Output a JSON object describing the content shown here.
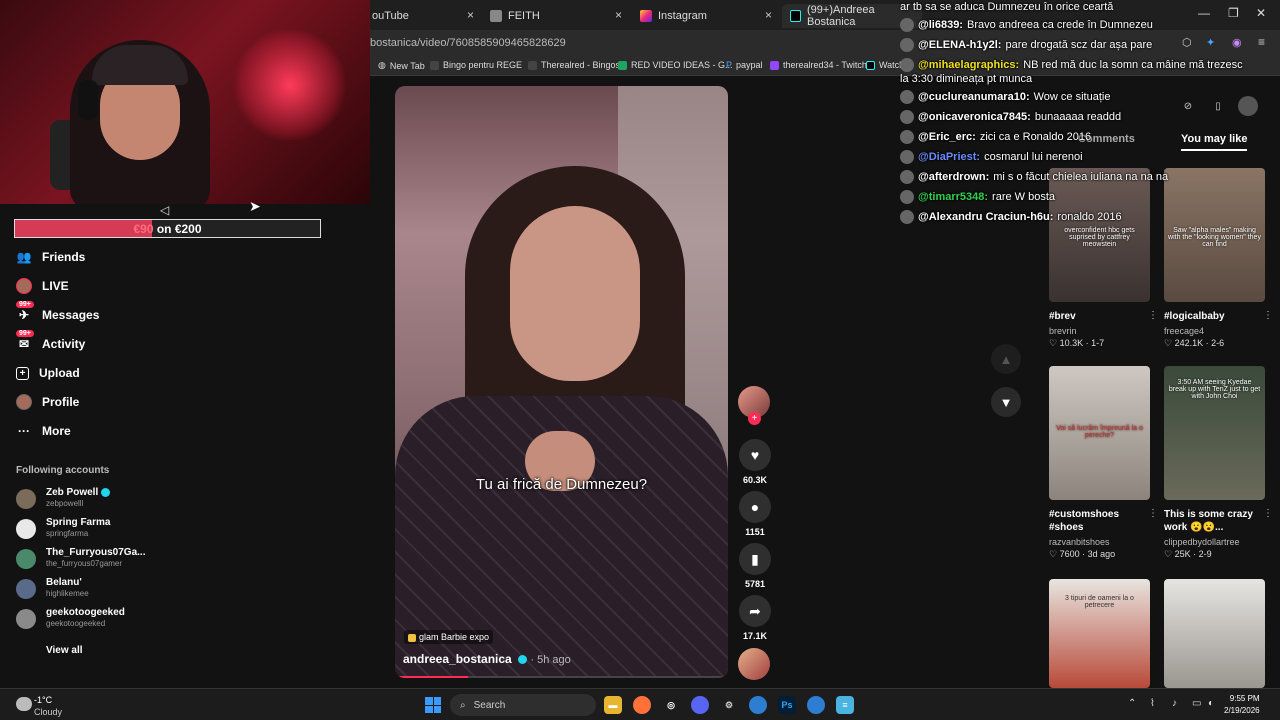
{
  "browser": {
    "tabs": [
      {
        "label": "ouTube",
        "close": "×"
      },
      {
        "label": "FEITH",
        "close": "×"
      },
      {
        "label": "Instagram",
        "close": "×"
      },
      {
        "label": "(99+)Andreea Bostanica",
        "close": "×"
      }
    ],
    "url": "bostanica/video/7608585909465828629",
    "bookmarks": [
      "New Tab",
      "Bingo pentru REGE",
      "Therealred - Bingos",
      "RED VIDEO IDEAS - G...",
      "paypal",
      "therealred34 - Twitch",
      "Watch"
    ],
    "window_controls": [
      "—",
      "❐",
      "✕"
    ]
  },
  "stream": {
    "donation_text_amount": "€90",
    "donation_text_rest": " on €200",
    "donation_progress": 0.45
  },
  "sidebar": {
    "items": [
      {
        "label": "Friends",
        "icon": "friends-icon"
      },
      {
        "label": "LIVE",
        "icon": "live-icon"
      },
      {
        "label": "Messages",
        "icon": "messages-icon",
        "badge": "99+"
      },
      {
        "label": "Activity",
        "icon": "activity-icon",
        "badge": "99+"
      },
      {
        "label": "Upload",
        "icon": "upload-icon"
      },
      {
        "label": "Profile",
        "icon": "profile-icon"
      },
      {
        "label": "More",
        "icon": "more-icon"
      }
    ],
    "following_header": "Following accounts",
    "accounts": [
      {
        "name": "Zeb Powell",
        "handle": "zebpowelll",
        "verified": true,
        "color": "#7a6b5a"
      },
      {
        "name": "Spring Farma",
        "handle": "springfarma",
        "verified": false,
        "color": "#e8e8e8"
      },
      {
        "name": "The_Furryous07Ga...",
        "handle": "the_furryous07gamer",
        "verified": false,
        "color": "#4a8a6a"
      },
      {
        "name": "Belanu'",
        "handle": "highlikemee",
        "verified": false,
        "color": "#5a6b8a"
      },
      {
        "name": "geekotoogeeked",
        "handle": "geekotoogeeked",
        "verified": false,
        "color": "#8a8a8a"
      }
    ],
    "view_all": "View all"
  },
  "video": {
    "caption": "Tu ai frică de Dumnezeu?",
    "tag": "glam Barbie expo",
    "author": "andreea_bostanica",
    "ago": "· 5h ago",
    "progress": 0.22
  },
  "actions": {
    "likes": "60.3K",
    "comments": "1151",
    "saves": "5781",
    "shares": "17.1K"
  },
  "chat": [
    {
      "user": "",
      "msg": "ar tb sa se aduca Dumnezeu în orice ceartă",
      "color": "#ffffff"
    },
    {
      "user": "@li6839:",
      "msg": "Bravo andreea ca crede în Dumnezeu",
      "color": "#ffffff"
    },
    {
      "user": "@ELENA-h1y2l:",
      "msg": "pare drogată scz dar așa pare",
      "color": "#ffffff"
    },
    {
      "user": "@mihaelagraphics:",
      "msg": "NB red mă duc la somn ca mâine mă trezesc",
      "color": "#f0e020"
    },
    {
      "user": "",
      "msg": "la 3:30 dimineața pt munca",
      "color": "#ffffff"
    },
    {
      "user": "@cuclureanumara10:",
      "msg": "Wow ce situație",
      "color": "#ffffff"
    },
    {
      "user": "@onicaveronica7845:",
      "msg": "bunaaaaa readdd",
      "color": "#ffffff"
    },
    {
      "user": "@Eric_erc:",
      "msg": "zici ca e Ronaldo 2016",
      "color": "#ffffff"
    },
    {
      "user": "@DiaPriest:",
      "msg": "cosmarul lui nerenoi",
      "color": "#6a8cff"
    },
    {
      "user": "@afterdrown:",
      "msg": "mi s o făcut chielea iuliana na na na",
      "color": "#ffffff"
    },
    {
      "user": "@timarr5348:",
      "msg": "rare W bosta",
      "color": "#30d050"
    },
    {
      "user": "@Alexandru Craciun-h6u:",
      "msg": "ronaldo 2016",
      "color": "#ffffff"
    }
  ],
  "right_panel": {
    "tabs": [
      "Comments",
      "You may like"
    ],
    "items": [
      {
        "title": "#brev",
        "user": "brevrin",
        "likes": "10.3K",
        "age": "1-7",
        "thumb_text": "overconfident hbc gets suprised by cattfrey meowstein",
        "color": "#6a5a55"
      },
      {
        "title": "#logicalbaby",
        "user": "freecage4",
        "likes": "242.1K",
        "age": "2-6",
        "thumb_text": "Saw \"alpha males\" making with the \"looking women\" they can find",
        "color": "#8a7565"
      },
      {
        "title": "#customshoes #shoes",
        "user": "razvanbitshoes",
        "likes": "7600",
        "age": "3d ago",
        "thumb_text": "Voi să lucrăm împreună la o pereche?",
        "color": "#b8b0aa"
      },
      {
        "title": "This is some crazy work 😮😮...",
        "user": "clippedbydollartree",
        "likes": "25K",
        "age": "2-9",
        "thumb_text": "3:50 AM seeing Kyedae break up with TenZ just to get with John Choi",
        "color": "#4a5a4a"
      },
      {
        "title": "",
        "user": "",
        "likes": "",
        "age": "",
        "thumb_text": "3 tipuri de oameni la o petrecere",
        "color": "#b84a3a"
      },
      {
        "title": "",
        "user": "",
        "likes": "",
        "age": "",
        "thumb_text": "",
        "color": "#dad8d5"
      }
    ]
  },
  "taskbar": {
    "temp": "-1°C",
    "weather": "Cloudy",
    "search": "Search",
    "time": "9:55 PM",
    "date": "2/19/2026"
  }
}
